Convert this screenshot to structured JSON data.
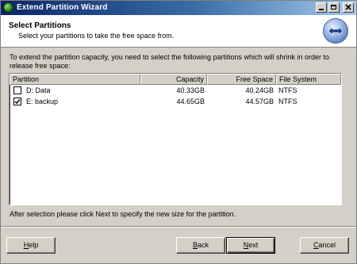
{
  "window": {
    "title": "Extend Partition Wizard"
  },
  "header": {
    "title": "Select Partitions",
    "subtitle": "Select your partitions to take the free space from."
  },
  "instructions": "To extend the partition capacity, you need to select the following partitions which will shrink in order to release free space:",
  "table": {
    "columns": [
      "Partition",
      "Capacity",
      "Free Space",
      "File System"
    ],
    "rows": [
      {
        "name": "D: Data",
        "capacity": "40.33GB",
        "free_space": "40.24GB",
        "file_system": "NTFS",
        "checked": false
      },
      {
        "name": "E: backup",
        "capacity": "44.65GB",
        "free_space": "44.57GB",
        "file_system": "NTFS",
        "checked": true
      }
    ]
  },
  "footer_note": "After selection please click Next to specify the new size for the partition.",
  "buttons": {
    "help_mn": "H",
    "help_rest": "elp",
    "back_mn": "B",
    "back_rest": "ack",
    "next_mn": "N",
    "next_rest": "ext",
    "cancel_mn": "C",
    "cancel_rest": "ancel"
  },
  "icons": {
    "app": "app-disk-icon",
    "logo": "wizard-arrows-icon",
    "minimize": "minimize-icon",
    "maximize": "maximize-icon",
    "close": "close-icon"
  }
}
